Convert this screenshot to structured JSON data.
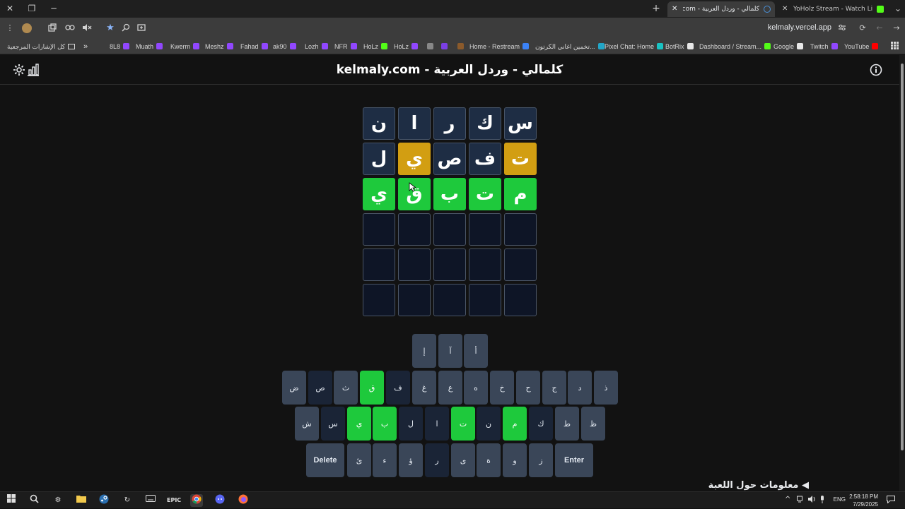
{
  "window": {
    "close": "✕",
    "restore": "❐",
    "minimize": "─"
  },
  "tabs": [
    {
      "title": "كلمالي - وردل العربية - kelmaly.com",
      "active": true,
      "fav": "#4a90d9"
    },
    {
      "title": "YoHolz Stream - Watch Live on",
      "active": false,
      "fav": "#53fc18"
    }
  ],
  "new_tab": "+",
  "tab_menu": "⌄",
  "toolbar": {
    "url": "kelmaly.vercel.app",
    "menu": "⋮"
  },
  "bookmarks": {
    "all_bookmarks": "كل الإشارات المرجعية",
    "more": "»",
    "items": [
      {
        "label": "8L8",
        "color": "#9147ff"
      },
      {
        "label": "Muath",
        "color": "#9147ff"
      },
      {
        "label": "Kwerm",
        "color": "#9147ff"
      },
      {
        "label": "Meshz",
        "color": "#9147ff"
      },
      {
        "label": "Fahad",
        "color": "#9147ff"
      },
      {
        "label": "ak90",
        "color": "#9147ff"
      },
      {
        "label": "Lozh",
        "color": "#9147ff"
      },
      {
        "label": "NFR",
        "color": "#9147ff"
      },
      {
        "label": "HoLz",
        "color": "#53fc18"
      },
      {
        "label": "HoLz",
        "color": "#9147ff"
      },
      {
        "label": "",
        "color": "#888888"
      },
      {
        "label": "",
        "color": "#7b3fe4"
      },
      {
        "label": "",
        "color": "#8b5a2b"
      },
      {
        "label": "Home - Restream",
        "color": "#3b82f6"
      },
      {
        "label": "تخمين اغاني الكرتون...",
        "color": "#22a6c8"
      },
      {
        "label": "Pixel Chat: Home",
        "color": "#19c3c3"
      },
      {
        "label": "BotRix",
        "color": "#e8e8e8"
      },
      {
        "label": "Dashboard / Stream...",
        "color": "#53fc18"
      },
      {
        "label": "Google",
        "color": "#e8e8e8"
      },
      {
        "label": "Twitch",
        "color": "#9147ff"
      },
      {
        "label": "YouTube",
        "color": "#ff0000"
      }
    ]
  },
  "game": {
    "title": "kelmaly.com - كلمالي - وردل العربية",
    "info_link": "◀ معلومات حول اللعبة",
    "board": [
      [
        {
          "l": "ن",
          "s": "absent"
        },
        {
          "l": "ا",
          "s": "absent"
        },
        {
          "l": "ر",
          "s": "absent"
        },
        {
          "l": "ك",
          "s": "absent"
        },
        {
          "l": "س",
          "s": "absent"
        }
      ],
      [
        {
          "l": "ل",
          "s": "absent"
        },
        {
          "l": "ي",
          "s": "present"
        },
        {
          "l": "ص",
          "s": "absent"
        },
        {
          "l": "ف",
          "s": "absent"
        },
        {
          "l": "ت",
          "s": "present"
        }
      ],
      [
        {
          "l": "ي",
          "s": "correct"
        },
        {
          "l": "ق",
          "s": "correct"
        },
        {
          "l": "ب",
          "s": "correct"
        },
        {
          "l": "ت",
          "s": "correct"
        },
        {
          "l": "م",
          "s": "correct"
        }
      ],
      [
        {
          "l": "",
          "s": "empty"
        },
        {
          "l": "",
          "s": "empty"
        },
        {
          "l": "",
          "s": "empty"
        },
        {
          "l": "",
          "s": "empty"
        },
        {
          "l": "",
          "s": "empty"
        }
      ],
      [
        {
          "l": "",
          "s": "empty"
        },
        {
          "l": "",
          "s": "empty"
        },
        {
          "l": "",
          "s": "empty"
        },
        {
          "l": "",
          "s": "empty"
        },
        {
          "l": "",
          "s": "empty"
        }
      ],
      [
        {
          "l": "",
          "s": "empty"
        },
        {
          "l": "",
          "s": "empty"
        },
        {
          "l": "",
          "s": "empty"
        },
        {
          "l": "",
          "s": "empty"
        },
        {
          "l": "",
          "s": "empty"
        }
      ]
    ],
    "keyboard": [
      [
        {
          "k": "إ",
          "s": ""
        },
        {
          "k": "آ",
          "s": ""
        },
        {
          "k": "أ",
          "s": ""
        }
      ],
      [
        {
          "k": "ض",
          "s": ""
        },
        {
          "k": "ص",
          "s": "absent"
        },
        {
          "k": "ث",
          "s": ""
        },
        {
          "k": "ق",
          "s": "correct"
        },
        {
          "k": "ف",
          "s": "absent"
        },
        {
          "k": "غ",
          "s": ""
        },
        {
          "k": "ع",
          "s": ""
        },
        {
          "k": "ه",
          "s": ""
        },
        {
          "k": "خ",
          "s": ""
        },
        {
          "k": "ح",
          "s": ""
        },
        {
          "k": "ج",
          "s": ""
        },
        {
          "k": "د",
          "s": ""
        },
        {
          "k": "ذ",
          "s": ""
        }
      ],
      [
        {
          "k": "ش",
          "s": ""
        },
        {
          "k": "س",
          "s": "absent"
        },
        {
          "k": "ي",
          "s": "correct"
        },
        {
          "k": "ب",
          "s": "correct"
        },
        {
          "k": "ل",
          "s": "absent"
        },
        {
          "k": "ا",
          "s": "absent"
        },
        {
          "k": "ت",
          "s": "correct"
        },
        {
          "k": "ن",
          "s": "absent"
        },
        {
          "k": "م",
          "s": "correct"
        },
        {
          "k": "ك",
          "s": "absent"
        },
        {
          "k": "ط",
          "s": ""
        },
        {
          "k": "ظ",
          "s": ""
        }
      ],
      [
        {
          "k": "Delete",
          "s": "wide"
        },
        {
          "k": "ئ",
          "s": ""
        },
        {
          "k": "ء",
          "s": ""
        },
        {
          "k": "ؤ",
          "s": ""
        },
        {
          "k": "ر",
          "s": "absent"
        },
        {
          "k": "ى",
          "s": ""
        },
        {
          "k": "ة",
          "s": ""
        },
        {
          "k": "و",
          "s": ""
        },
        {
          "k": "ز",
          "s": ""
        },
        {
          "k": "Enter",
          "s": "wide"
        }
      ]
    ]
  },
  "taskbar": {
    "lang": "ENG",
    "time": "2:58:18 PM",
    "date": "7/29/2025"
  },
  "colors": {
    "correct": "#1ec93c",
    "present": "#d29e12",
    "absent": "#1e2d44"
  }
}
